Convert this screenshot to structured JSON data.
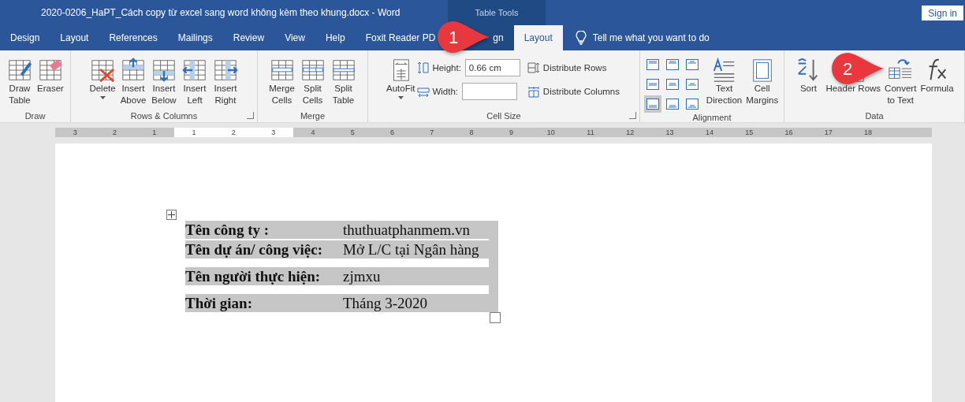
{
  "window": {
    "title": "2020-0206_HaPT_Cách copy từ excel sang word không kèm theo khung.docx  -  Word",
    "context_label": "Table Tools",
    "sign_in": "Sign in"
  },
  "tabs": [
    {
      "label": "Design",
      "selected": false,
      "contextual": false
    },
    {
      "label": "Layout",
      "selected": false,
      "contextual": false
    },
    {
      "label": "References",
      "selected": false,
      "contextual": false
    },
    {
      "label": "Mailings",
      "selected": false,
      "contextual": false
    },
    {
      "label": "Review",
      "selected": false,
      "contextual": false
    },
    {
      "label": "View",
      "selected": false,
      "contextual": false
    },
    {
      "label": "Help",
      "selected": false,
      "contextual": false
    },
    {
      "label": "Foxit Reader PD",
      "selected": false,
      "contextual": false
    },
    {
      "label": "gn",
      "selected": false,
      "contextual": true
    },
    {
      "label": "Layout",
      "selected": true,
      "contextual": true
    }
  ],
  "tell_me": "Tell me what you want to do",
  "ribbon": {
    "groups": [
      {
        "label": "Draw",
        "launcher": false,
        "items": [
          {
            "kind": "large",
            "lines": [
              "Draw",
              "Table"
            ],
            "dropdown": false
          },
          {
            "kind": "large",
            "lines": [
              "Eraser"
            ],
            "dropdown": false
          }
        ]
      },
      {
        "label": "Rows & Columns",
        "launcher": true,
        "items": [
          {
            "kind": "large",
            "lines": [
              "Delete"
            ],
            "dropdown": true
          },
          {
            "kind": "large",
            "lines": [
              "Insert",
              "Above"
            ],
            "dropdown": false
          },
          {
            "kind": "large",
            "lines": [
              "Insert",
              "Below"
            ],
            "dropdown": false
          },
          {
            "kind": "large",
            "lines": [
              "Insert",
              "Left"
            ],
            "dropdown": false
          },
          {
            "kind": "large",
            "lines": [
              "Insert",
              "Right"
            ],
            "dropdown": false
          }
        ]
      },
      {
        "label": "Merge",
        "launcher": false,
        "items": [
          {
            "kind": "large",
            "lines": [
              "Merge",
              "Cells"
            ],
            "dropdown": false
          },
          {
            "kind": "large",
            "lines": [
              "Split",
              "Cells"
            ],
            "dropdown": false
          },
          {
            "kind": "large",
            "lines": [
              "Split",
              "Table"
            ],
            "dropdown": false
          }
        ]
      },
      {
        "label": "Cell Size",
        "launcher": true,
        "items": [
          {
            "kind": "large",
            "lines": [
              "AutoFit"
            ],
            "dropdown": true
          },
          {
            "kind": "fields",
            "rows": [
              {
                "label": "Height:",
                "value": "0.66 cm"
              },
              {
                "label": "Width:"
              }
            ]
          },
          {
            "kind": "small",
            "rows": [
              {
                "label": "Distribute Rows"
              },
              {
                "label": "Distribute Columns"
              }
            ]
          }
        ]
      },
      {
        "label": "Alignment",
        "launcher": false,
        "items": [
          {
            "kind": "align",
            "cells": [
              {
                "selected": false
              },
              {
                "selected": false
              },
              {
                "selected": false
              },
              {
                "selected": false
              },
              {
                "selected": false
              },
              {
                "selected": false
              },
              {
                "selected": true
              },
              {
                "selected": false
              },
              {
                "selected": false
              }
            ]
          },
          {
            "kind": "large",
            "lines": [
              "Text",
              "Direction"
            ],
            "dropdown": false
          },
          {
            "kind": "large",
            "lines": [
              "Cell",
              "Margins"
            ],
            "dropdown": false
          }
        ]
      },
      {
        "label": "Data",
        "launcher": false,
        "items": [
          {
            "kind": "large",
            "lines": [
              "Sort"
            ],
            "dropdown": false
          },
          {
            "kind": "large",
            "lines": [
              "Header Rows"
            ],
            "dropdown": false
          },
          {
            "kind": "large",
            "lines": [
              "Convert",
              "to Text"
            ],
            "dropdown": false
          },
          {
            "kind": "large",
            "lines": [
              "Formula"
            ],
            "dropdown": false
          }
        ]
      }
    ]
  },
  "callouts": [
    {
      "number": "1"
    },
    {
      "number": "2"
    }
  ],
  "ruler": {
    "marks": [
      {
        "label": "3",
        "margin": true
      },
      {
        "label": "2",
        "margin": true
      },
      {
        "label": "1",
        "margin": true
      },
      {
        "label": "1",
        "margin": false
      },
      {
        "label": "2",
        "margin": false
      },
      {
        "label": "3",
        "margin": false
      },
      {
        "label": "4",
        "margin": true
      },
      {
        "label": "5",
        "margin": true
      },
      {
        "label": "6",
        "margin": true
      },
      {
        "label": "7",
        "margin": true
      },
      {
        "label": "8",
        "margin": true
      },
      {
        "label": "9",
        "margin": true
      },
      {
        "label": "10",
        "margin": true
      },
      {
        "label": "11",
        "margin": true
      },
      {
        "label": "12",
        "margin": true
      },
      {
        "label": "13",
        "margin": true
      },
      {
        "label": "14",
        "margin": true
      },
      {
        "label": "15",
        "margin": true
      },
      {
        "label": "16",
        "margin": true
      },
      {
        "label": "17",
        "margin": true
      },
      {
        "label": "18",
        "margin": true
      }
    ]
  },
  "document": {
    "table": {
      "rows": [
        {
          "label": "Tên công ty :",
          "value": "thuthuatphanmem.vn"
        },
        {
          "label": "Tên dự án/ công việc:",
          "value": "Mở L/C tại Ngân hàng"
        },
        {
          "label": "Tên người thực hiện:",
          "value": "zjmxu"
        },
        {
          "label": "Thời gian:",
          "value": "Tháng 3-2020"
        }
      ]
    }
  }
}
